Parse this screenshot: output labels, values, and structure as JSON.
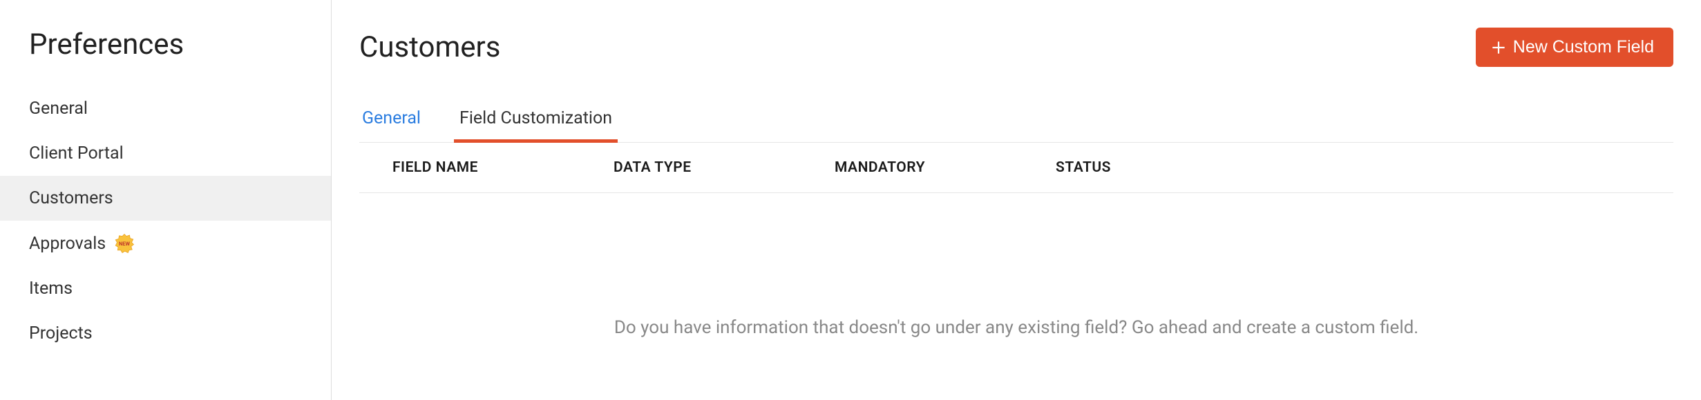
{
  "sidebar": {
    "title": "Preferences",
    "items": [
      {
        "label": "General",
        "active": false,
        "badge": null
      },
      {
        "label": "Client Portal",
        "active": false,
        "badge": null
      },
      {
        "label": "Customers",
        "active": true,
        "badge": null
      },
      {
        "label": "Approvals",
        "active": false,
        "badge": "NEW"
      },
      {
        "label": "Items",
        "active": false,
        "badge": null
      },
      {
        "label": "Projects",
        "active": false,
        "badge": null
      }
    ]
  },
  "page": {
    "title": "Customers",
    "new_button_label": "New Custom Field"
  },
  "tabs": [
    {
      "label": "General",
      "active": false
    },
    {
      "label": "Field Customization",
      "active": true
    }
  ],
  "table": {
    "columns": [
      "FIELD NAME",
      "DATA TYPE",
      "MANDATORY",
      "STATUS"
    ],
    "rows": []
  },
  "empty_state": {
    "message": "Do you have information that doesn't go under any existing field? Go ahead and create a custom field."
  },
  "colors": {
    "accent": "#e24f2b",
    "link": "#2b7de0"
  }
}
